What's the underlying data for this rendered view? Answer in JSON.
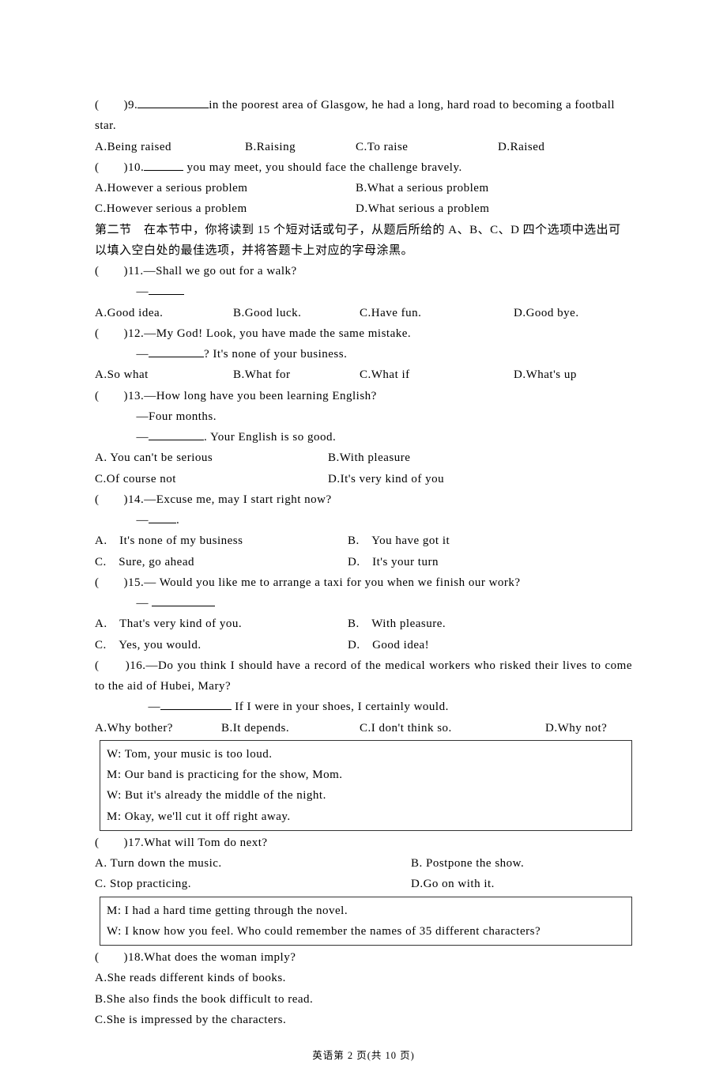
{
  "q9": {
    "prefix": "(　　)9.",
    "text_after_blank": "in the poorest area of Glasgow, he had a long, hard road to becoming a football star.",
    "a": "A.Being raised",
    "b": "B.Raising",
    "c": "C.To raise",
    "d": "D.Raised"
  },
  "q10": {
    "prefix": "(　　)10.",
    "text_after_blank": " you may meet, you should face the challenge bravely.",
    "a": "A.However a serious problem",
    "b": "B.What a serious problem",
    "c": "C.However serious a problem",
    "d": "D.What serious a problem"
  },
  "section2": "第二节　在本节中，你将读到 15 个短对话或句子，从题后所给的 A、B、C、D 四个选项中选出可以填入空白处的最佳选项，并将答题卡上对应的字母涂黑。",
  "q11": {
    "prefix": "(　　)11.—Shall we go out for a walk?",
    "dash": "—",
    "a": "A.Good idea.",
    "b": "B.Good luck.",
    "c": "C.Have fun.",
    "d": "D.Good bye."
  },
  "q12": {
    "prefix": "(　　)12.—My God! Look, you have made the same mistake.",
    "line2a": "—",
    "line2b": "? It's none of your business.",
    "a": "A.So what",
    "b": "B.What for",
    "c": "C.What if",
    "d": "D.What's up"
  },
  "q13": {
    "prefix": "(　　)13.—How long have you been learning English?",
    "line2": "—Four months.",
    "line3a": "—",
    "line3b": ". Your English is so good.",
    "a": "A. You can't be serious",
    "b": "B.With pleasure",
    "c": "C.Of course not",
    "d": "D.It's very kind of you"
  },
  "q14": {
    "prefix": "(　　)14.—Excuse me, may I start right now?",
    "dash": "—",
    "dashsuffix": ".",
    "a": "A.　It's none of my business",
    "b": "B.　You have got it",
    "c": "C.　Sure, go ahead",
    "d": "D.　It's your turn"
  },
  "q15": {
    "prefix": "(　　)15.— Would you like me to arrange a taxi for you when we finish our work?",
    "dash": "— ",
    "a": "A.　That's very kind of you.",
    "b": "B.　With pleasure.",
    "c": "C.　Yes, you would.",
    "d": "D.　Good idea!"
  },
  "q16": {
    "line1": "(　　)16.—Do you think I should have a record of the medical workers who risked their lives to come to the aid of Hubei, Mary?",
    "line2a": "—",
    "line2b": " If I were in your shoes, I certainly would.",
    "a": "A.Why bother?",
    "b": "B.It depends.",
    "c": "C.I don't think so.",
    "d": "D.Why not?"
  },
  "box1": {
    "l1": "W: Tom, your music is too loud.",
    "l2": "M: Our band is practicing for the show, Mom.",
    "l3": "W: But it's already the middle of the night.",
    "l4": "M: Okay, we'll cut it off right away."
  },
  "q17": {
    "prefix": "(　　)17.What will Tom do next?",
    "a": "A. Turn down the music.",
    "b": "B. Postpone the show.",
    "c": "C. Stop practicing.",
    "d": "D.Go on with it."
  },
  "box2": {
    "l1": "M: I had a hard time getting through the novel.",
    "l2": "W: I know how you feel. Who could remember the names of 35 different characters?"
  },
  "q18": {
    "prefix": "(　　)18.What does the woman imply?",
    "a": "A.She reads different kinds of books.",
    "b": "B.She also finds the book difficult to read.",
    "c": "C.She is impressed by the characters."
  },
  "footer": "英语第 2 页(共 10 页)"
}
